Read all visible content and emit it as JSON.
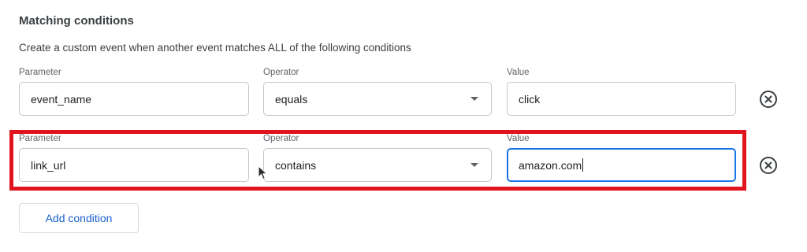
{
  "section": {
    "title": "Matching conditions",
    "description": "Create a custom event when another event matches ALL of the following conditions"
  },
  "conditions": [
    {
      "parameter_label": "Parameter",
      "parameter_value": "event_name",
      "operator_label": "Operator",
      "operator_value": "equals",
      "value_label": "Value",
      "value_value": "click"
    },
    {
      "parameter_label": "Parameter",
      "parameter_value": "link_url",
      "operator_label": "Operator",
      "operator_value": "contains",
      "value_label": "Value",
      "value_value": "amazon.com"
    }
  ],
  "icons": {
    "remove": "remove-circle-icon",
    "dropdown": "dropdown-arrow-icon",
    "pointer": "mouse-pointer-icon"
  },
  "add_condition_label": "Add condition",
  "colors": {
    "highlight": "#e0141e",
    "focus": "#1a73e8",
    "link": "#1a5fd0"
  }
}
